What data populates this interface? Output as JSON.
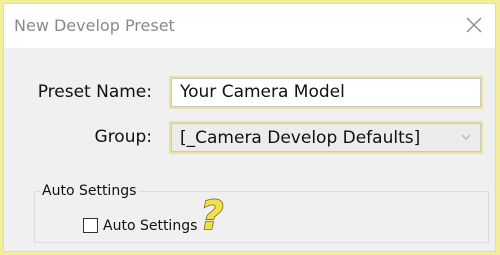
{
  "dialog": {
    "title": "New Develop Preset",
    "close_icon": "close-icon"
  },
  "form": {
    "preset_name_label": "Preset Name:",
    "preset_name_value": "Your Camera Model",
    "group_label": "Group:",
    "group_value": "[_Camera Develop Defaults]",
    "group_dropdown_icon": "chevron-down-icon"
  },
  "auto_settings": {
    "group_title": "Auto Settings",
    "checkbox_label": "Auto Settings",
    "checked": false
  },
  "annotation": {
    "icon": "question-mark-icon"
  },
  "colors": {
    "highlight_background": "#f3ee99",
    "dialog_background": "#f0f0f0",
    "question_mark_fill": "#f2e04a",
    "question_mark_outline": "#7a6a10"
  }
}
